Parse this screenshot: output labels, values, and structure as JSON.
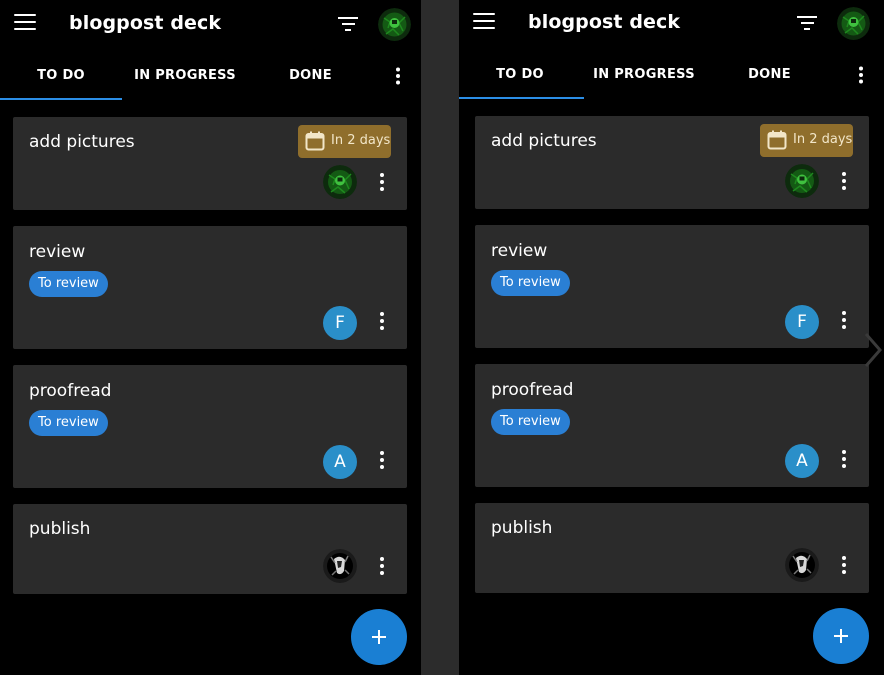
{
  "app": {
    "title": "blogpost deck",
    "menu_icon": "hamburger-menu-icon",
    "filter_icon": "filter-icon",
    "user_avatar": "user-avatar-green"
  },
  "tabs": [
    {
      "label": "TO DO",
      "active": true
    },
    {
      "label": "IN PROGRESS",
      "active": false
    },
    {
      "label": "DONE",
      "active": false
    }
  ],
  "cards": [
    {
      "title": "add pictures",
      "due": "In 2 days",
      "labels": [],
      "assignee": "green-avatar"
    },
    {
      "title": "review",
      "due": "",
      "labels": [
        "To review"
      ],
      "assignee": "F"
    },
    {
      "title": "proofread",
      "due": "",
      "labels": [
        "To review"
      ],
      "assignee": "A"
    },
    {
      "title": "publish",
      "due": "",
      "labels": [],
      "assignee": "bw-avatar"
    }
  ],
  "colors": {
    "accent": "#2b8ee6",
    "card_bg": "#2b2b2b",
    "due_badge": "#8f6e2c",
    "label_chip": "#2a7fd4",
    "fab": "#1a7fd3"
  }
}
